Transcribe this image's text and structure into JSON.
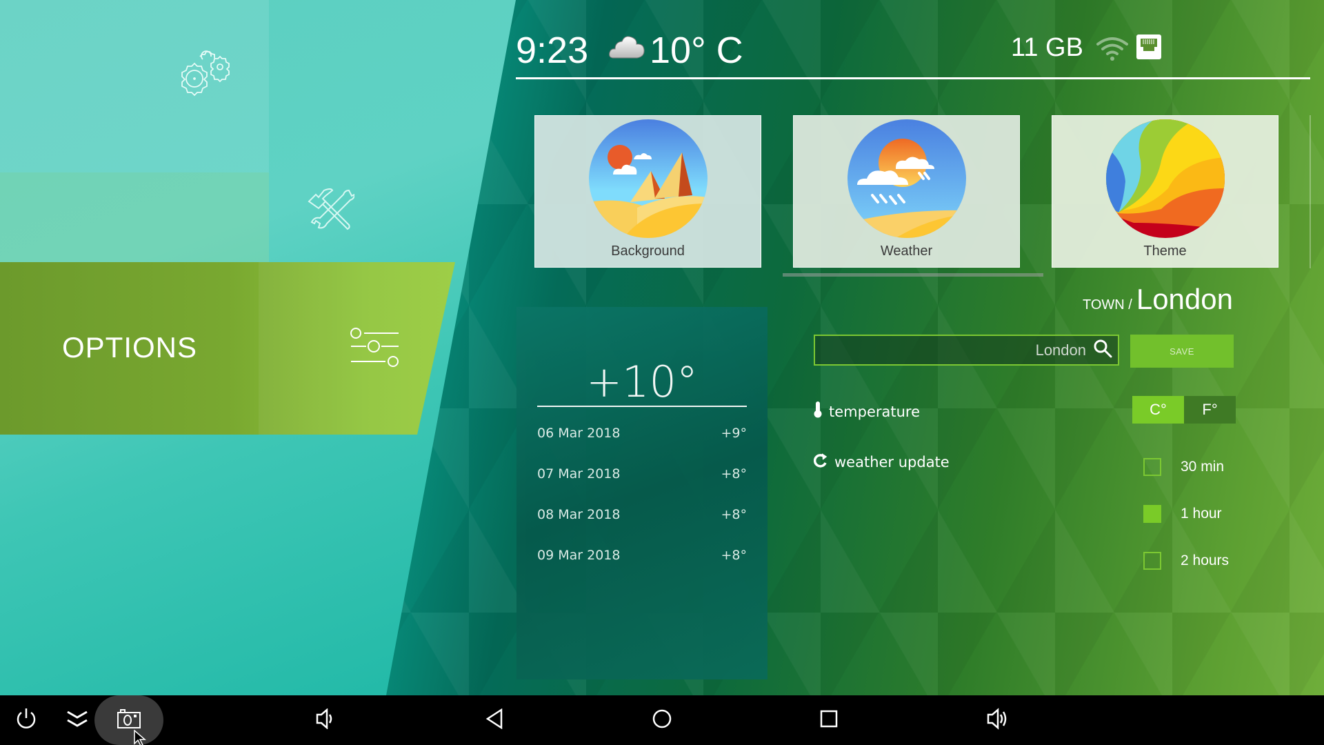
{
  "status_bar": {
    "time": "9:23",
    "weather_icon": "cloud-icon",
    "current_temp": "10° C",
    "storage": "11 GB",
    "wifi_icon": "wifi-icon",
    "ethernet_icon": "ethernet-icon"
  },
  "sidebar": {
    "items": [
      {
        "label": "",
        "icon": "gears-icon"
      },
      {
        "label": "",
        "icon": "tools-icon"
      },
      {
        "label": "OPTIONS",
        "icon": "sliders-icon",
        "active": true
      }
    ]
  },
  "tiles": [
    {
      "label": "Background",
      "icon": "desert-landscape-icon"
    },
    {
      "label": "Weather",
      "icon": "sun-rain-icon"
    },
    {
      "label": "Theme",
      "icon": "color-swirl-icon"
    }
  ],
  "forecast": {
    "current": "+10°",
    "days": [
      {
        "date": "06 Mar 2018",
        "temp": "+9°"
      },
      {
        "date": "07 Mar 2018",
        "temp": "+8°"
      },
      {
        "date": "08 Mar 2018",
        "temp": "+8°"
      },
      {
        "date": "09 Mar 2018",
        "temp": "+8°"
      }
    ]
  },
  "settings": {
    "town_label": "TOWN /",
    "town_name": "London",
    "search_value": "London",
    "save_label": "SAVE",
    "temperature_label": "temperature",
    "units": [
      {
        "label": "C°",
        "selected": true
      },
      {
        "label": "F°",
        "selected": false
      }
    ],
    "update_label": "weather update",
    "update_options": [
      {
        "label": "30 min",
        "selected": false
      },
      {
        "label": "1 hour",
        "selected": true
      },
      {
        "label": "2 hours",
        "selected": false
      }
    ]
  },
  "navbar": {
    "buttons": [
      "power",
      "collapse",
      "screenshot",
      "volume-down",
      "back",
      "home",
      "recents",
      "volume-up"
    ]
  },
  "colors": {
    "accent_green": "#7acb28",
    "unit_off": "#3f7a25",
    "forecast_card": "#065a4c"
  }
}
